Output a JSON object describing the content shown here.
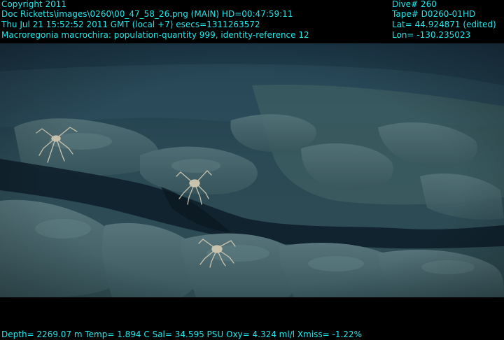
{
  "overlay": {
    "copyright": "Copyright 2011",
    "source_line": "Doc Ricketts\\images\\0260\\00_47_58_26.png (MAIN)  HD=00:47:59:11",
    "time_line": "Thu Jul 21 15:52:52 2011 GMT (local +7)  esecs=1311263572",
    "annotation_line": "Macroregonia macrochira: population-quantity 999, identity-reference 12",
    "dive": "Dive# 260",
    "tape": "Tape# D0260-01HD",
    "lat": "Lat= 44.924871 (edited)",
    "lon": "Lon= -130.235023",
    "sensor_line": "Depth= 2269.07 m  Temp= 1.894 C  Sal= 34.595 PSU  Oxy= 4.324 ml/l  Xmiss= -1.22%"
  },
  "colors": {
    "overlay_text": "#22e6ea",
    "water": "#1d3a4c",
    "rock": "#4a6a72",
    "shadow": "#0e1f2a",
    "crab": "#c9c2ad"
  },
  "scene": {
    "subject": "crab-icon",
    "crab_count_visible": 3
  }
}
